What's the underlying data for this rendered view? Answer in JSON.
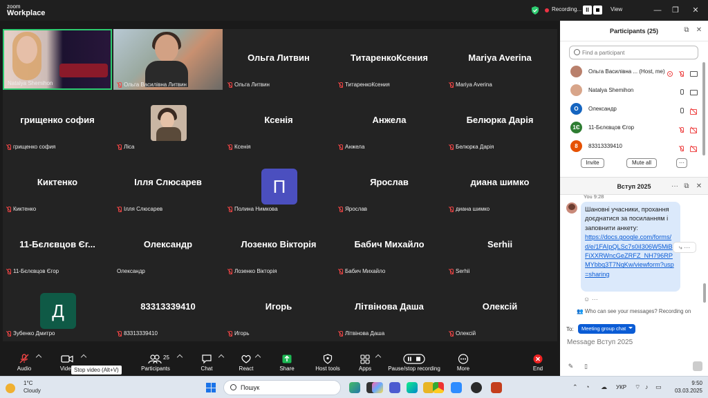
{
  "app": {
    "logo_small": "zoom",
    "logo_big": "Workplace"
  },
  "titlebar": {
    "recording_label": "Recording...",
    "pause_glyph": "II",
    "view_label": "View",
    "min_glyph": "—",
    "restore_glyph": "❐",
    "close_glyph": "✕"
  },
  "tiles": [
    {
      "big": "",
      "name": "Natalya Shemihon",
      "muted": false
    },
    {
      "big": "",
      "name": "Ольга Василівна Литвин",
      "muted": true
    },
    {
      "big": "Ольга Литвин",
      "name": "Ольга Литвин",
      "muted": true
    },
    {
      "big": "ТитаренкоКсения",
      "name": "ТитаренкоКсения",
      "muted": true
    },
    {
      "big": "Mariya Averina",
      "name": "Mariya Averina",
      "muted": true
    },
    {
      "big": "грищенко софия",
      "name": "грищенко софия",
      "muted": true
    },
    {
      "big": "",
      "name": "Ліса",
      "muted": true
    },
    {
      "big": "Ксенія",
      "name": "Ксенія",
      "muted": true
    },
    {
      "big": "Анжела",
      "name": "Анжела",
      "muted": true
    },
    {
      "big": "Белюрка Дарія",
      "name": "Белюрка Дарія",
      "muted": true
    },
    {
      "big": "Киктенко",
      "name": "Киктенко",
      "muted": true
    },
    {
      "big": "Ілля Слюсарев",
      "name": "Ілля Слюсарев",
      "muted": true
    },
    {
      "big": "",
      "name": "Полина Нимкова",
      "muted": true,
      "avatar_letter": "П",
      "avatar_color": "#4b4fbf"
    },
    {
      "big": "Ярослав",
      "name": "Ярослав",
      "muted": true
    },
    {
      "big": "диана шимко",
      "name": "диана шимко",
      "muted": true
    },
    {
      "big": "11-Бєлєвцов Єг...",
      "name": "11-Бєлєвцов Єгор",
      "muted": true
    },
    {
      "big": "Олександр",
      "name": "Олександр",
      "muted": false
    },
    {
      "big": "Лозенко Вікторія",
      "name": "Лозенко Вікторія",
      "muted": true
    },
    {
      "big": "Бабич Михайло",
      "name": "Бабич Михайло",
      "muted": true
    },
    {
      "big": "Serhii",
      "name": "Serhii",
      "muted": true
    },
    {
      "big": "",
      "name": "Зубенко Дмитро",
      "muted": true,
      "avatar_letter": "Д",
      "avatar_color": "#0f5a46"
    },
    {
      "big": "83313339410",
      "name": "83313339410",
      "muted": true
    },
    {
      "big": "Игорь",
      "name": "Игорь",
      "muted": true
    },
    {
      "big": "Літвінова Даша",
      "name": "Літвінова Даша",
      "muted": true
    },
    {
      "big": "Олексій",
      "name": "Олексій",
      "muted": true
    }
  ],
  "toolbar": {
    "audio": "Audio",
    "video": "Video",
    "participants": "Participants",
    "participants_count": "25",
    "chat": "Chat",
    "react": "React",
    "share": "Share",
    "host_tools": "Host tools",
    "apps": "Apps",
    "record": "Pause/stop recording",
    "more": "More",
    "end": "End",
    "tooltip": "Stop video (Alt+V)"
  },
  "participants_panel": {
    "title": "Participants (25)",
    "search_placeholder": "Find a participant",
    "rows": [
      {
        "name": "Ольга Василівна ... (Host, me)",
        "avatar_letter": "",
        "avatar_color": "#b9806c"
      },
      {
        "name": "Natalya Shemihon",
        "avatar_letter": "",
        "avatar_color": "#d8a58a"
      },
      {
        "name": "Олександр",
        "avatar_letter": "О",
        "avatar_color": "#1565c0"
      },
      {
        "name": "11-Бєлєвцов Єгор",
        "avatar_letter": "1Є",
        "avatar_color": "#2e7d32"
      },
      {
        "name": "83313339410",
        "avatar_letter": "8",
        "avatar_color": "#e65100"
      }
    ],
    "invite": "Invite",
    "mute_all": "Mute all",
    "more": "···"
  },
  "chat": {
    "title": "Вступ 2025",
    "sender": "You 9:28",
    "text": "Шановні учасники, прохання доєднатися за посиланням і заповнити анкету:",
    "link": "https://docs.google.com/forms/d/e/1FAIpQLSc7s0iI306W5MiBFiXXRWncGeZRFZ_NH796RPMYbbq3T7NqKw/viewform?usp=sharing",
    "warning": "Who can see your messages? Recording on",
    "to_label": "To:",
    "to_chip": "Meeting group chat",
    "input_placeholder": "Message Вступ 2025"
  },
  "taskbar": {
    "temp": "1°C",
    "weather": "Cloudy",
    "search": "Пошук",
    "lang": "УКР",
    "time": "9:50",
    "date": "03.03.2025"
  }
}
